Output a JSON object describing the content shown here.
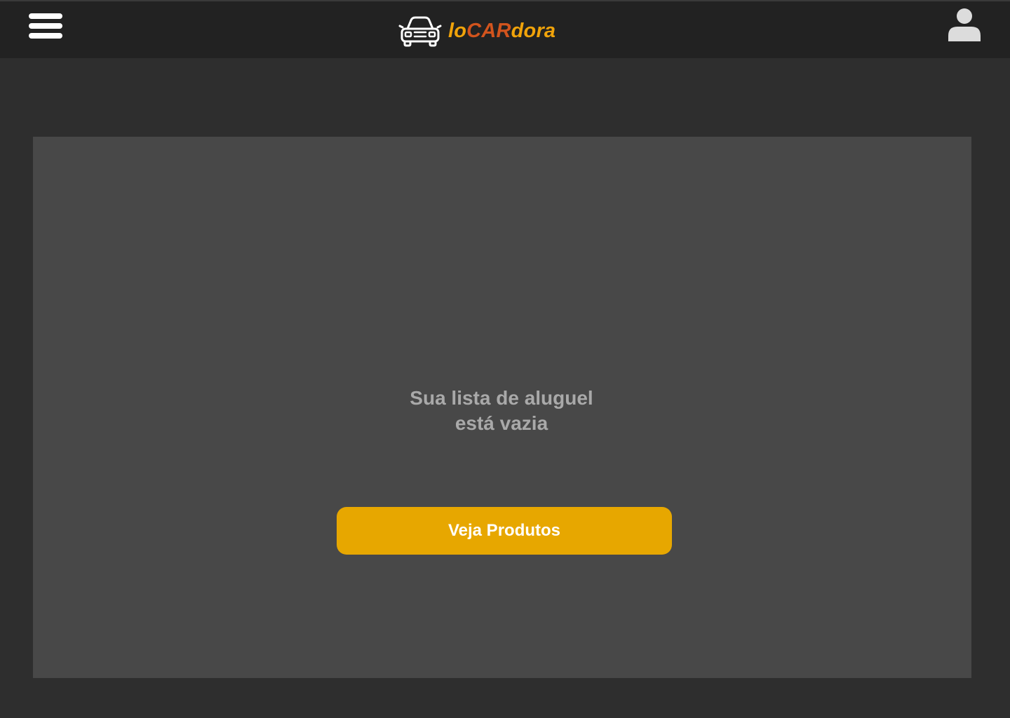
{
  "header": {
    "menu_icon": "hamburger-menu-icon",
    "logo": {
      "icon": "car-icon",
      "text_part1": "lo",
      "text_part2": "CAR",
      "text_part3": "dora"
    },
    "profile_icon": "user-icon"
  },
  "main": {
    "empty_message": "Sua lista de aluguel está vazia",
    "button_label": "Veja Produtos"
  },
  "colors": {
    "header_bg": "#222222",
    "page_bg": "#2e2e2e",
    "panel_bg": "#484848",
    "accent": "#e7a700",
    "logo_orange": "#f0a30a",
    "logo_red_orange": "#d2541d",
    "message_text": "#a9a9a9"
  }
}
